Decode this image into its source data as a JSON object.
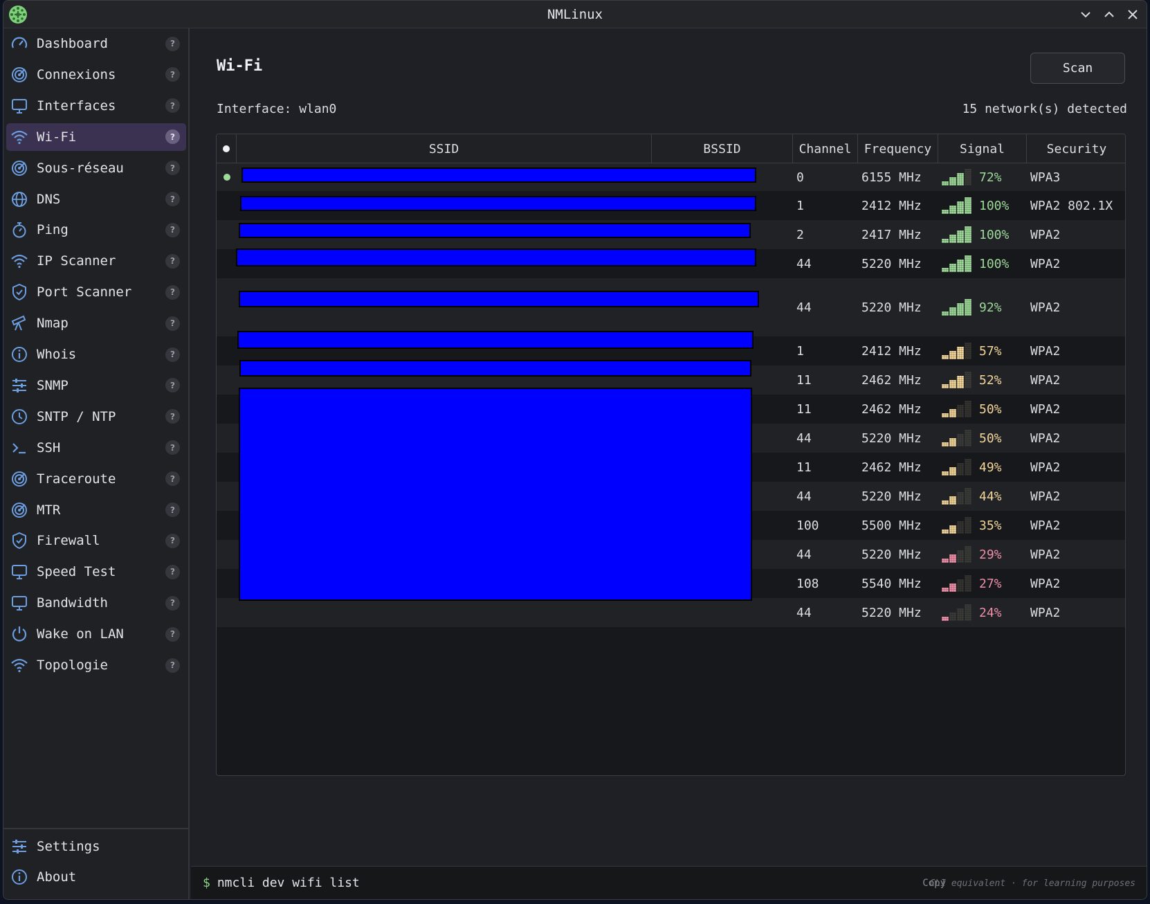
{
  "window": {
    "title": "NMLinux"
  },
  "sidebar": {
    "items": [
      {
        "label": "Dashboard",
        "icon": "gauge-icon",
        "help": "?"
      },
      {
        "label": "Connexions",
        "icon": "radar-icon",
        "help": "?"
      },
      {
        "label": "Interfaces",
        "icon": "monitor-icon",
        "help": "?"
      },
      {
        "label": "Wi-Fi",
        "icon": "wifi-icon",
        "help": "?",
        "active": true
      },
      {
        "label": "Sous-réseau",
        "icon": "radar-icon",
        "help": "?"
      },
      {
        "label": "DNS",
        "icon": "globe-icon",
        "help": "?"
      },
      {
        "label": "Ping",
        "icon": "stopwatch-icon",
        "help": "?"
      },
      {
        "label": "IP Scanner",
        "icon": "wifi-icon",
        "help": "?"
      },
      {
        "label": "Port Scanner",
        "icon": "shield-icon",
        "help": "?"
      },
      {
        "label": "Nmap",
        "icon": "telescope-icon",
        "help": "?"
      },
      {
        "label": "Whois",
        "icon": "info-icon",
        "help": "?"
      },
      {
        "label": "SNMP",
        "icon": "sliders-icon",
        "help": "?"
      },
      {
        "label": "SNTP / NTP",
        "icon": "clock-icon",
        "help": "?"
      },
      {
        "label": "SSH",
        "icon": "terminal-icon",
        "help": "?"
      },
      {
        "label": "Traceroute",
        "icon": "radar-icon",
        "help": "?"
      },
      {
        "label": "MTR",
        "icon": "radar-icon",
        "help": "?"
      },
      {
        "label": "Firewall",
        "icon": "shield-icon",
        "help": "?"
      },
      {
        "label": "Speed Test",
        "icon": "monitor-icon",
        "help": "?"
      },
      {
        "label": "Bandwidth",
        "icon": "monitor-icon",
        "help": "?"
      },
      {
        "label": "Wake on LAN",
        "icon": "power-icon",
        "help": "?"
      },
      {
        "label": "Topologie",
        "icon": "wifi-icon",
        "help": "?"
      }
    ],
    "bottom_items": [
      {
        "label": "Settings",
        "icon": "sliders-icon"
      },
      {
        "label": "About",
        "icon": "info-icon"
      }
    ]
  },
  "main": {
    "title": "Wi-Fi",
    "scan_label": "Scan",
    "interface_text": "Interface: wlan0",
    "count_text": "15 network(s) detected",
    "columns": [
      "SSID",
      "BSSID",
      "Channel",
      "Frequency",
      "Signal",
      "Security"
    ],
    "rows": [
      {
        "channel": "0",
        "frequency": "6155 MHz",
        "signal": 72,
        "signal_text": "72%",
        "security": "WPA3",
        "connected": true
      },
      {
        "channel": "1",
        "frequency": "2412 MHz",
        "signal": 100,
        "signal_text": "100%",
        "security": "WPA2 802.1X"
      },
      {
        "channel": "2",
        "frequency": "2417 MHz",
        "signal": 100,
        "signal_text": "100%",
        "security": "WPA2"
      },
      {
        "channel": "44",
        "frequency": "5220 MHz",
        "signal": 100,
        "signal_text": "100%",
        "security": "WPA2"
      },
      {
        "channel": "44",
        "frequency": "5220 MHz",
        "signal": 92,
        "signal_text": "92%",
        "security": "WPA2"
      },
      {
        "channel": "1",
        "frequency": "2412 MHz",
        "signal": 57,
        "signal_text": "57%",
        "security": "WPA2"
      },
      {
        "channel": "11",
        "frequency": "2462 MHz",
        "signal": 52,
        "signal_text": "52%",
        "security": "WPA2"
      },
      {
        "channel": "11",
        "frequency": "2462 MHz",
        "signal": 50,
        "signal_text": "50%",
        "security": "WPA2"
      },
      {
        "channel": "44",
        "frequency": "5220 MHz",
        "signal": 50,
        "signal_text": "50%",
        "security": "WPA2"
      },
      {
        "channel": "11",
        "frequency": "2462 MHz",
        "signal": 49,
        "signal_text": "49%",
        "security": "WPA2"
      },
      {
        "channel": "44",
        "frequency": "5220 MHz",
        "signal": 44,
        "signal_text": "44%",
        "security": "WPA2"
      },
      {
        "channel": "100",
        "frequency": "5500 MHz",
        "signal": 35,
        "signal_text": "35%",
        "security": "WPA2"
      },
      {
        "channel": "44",
        "frequency": "5220 MHz",
        "signal": 29,
        "signal_text": "29%",
        "security": "WPA2"
      },
      {
        "channel": "108",
        "frequency": "5540 MHz",
        "signal": 27,
        "signal_text": "27%",
        "security": "WPA2"
      },
      {
        "channel": "44",
        "frequency": "5220 MHz",
        "signal": 24,
        "signal_text": "24%",
        "security": "WPA2"
      }
    ]
  },
  "colors": {
    "accent": "#6c9ee0",
    "signal_high": "#9ed99a",
    "signal_mid": "#f3d69a",
    "signal_low": "#ee8fa8",
    "active_nav": "#3b3150"
  },
  "footer": {
    "prompt": "$",
    "command": "nmcli dev wifi list",
    "copy_label": "Copy",
    "note": "CLI equivalent · for learning purposes"
  }
}
